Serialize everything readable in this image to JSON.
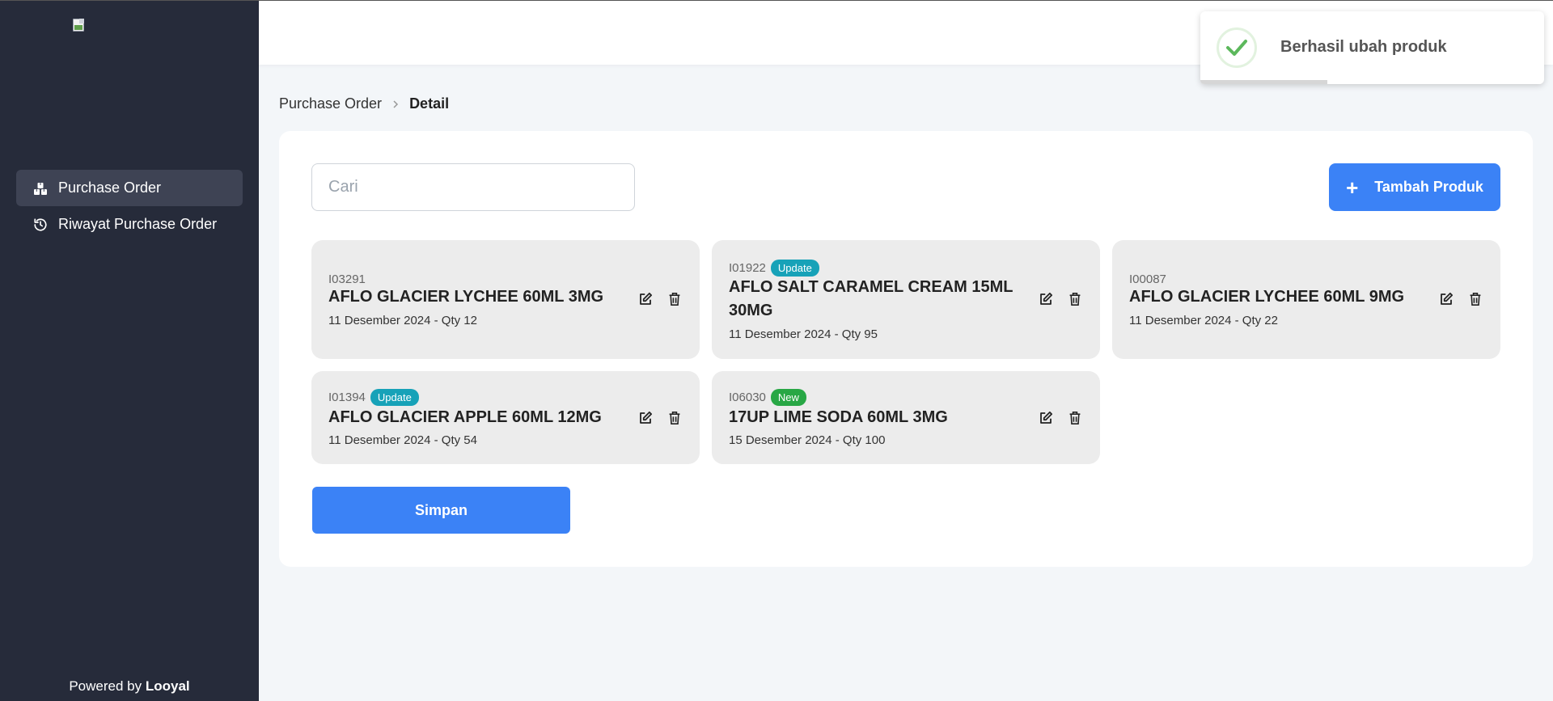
{
  "sidebar": {
    "items": [
      {
        "label": "Purchase Order",
        "icon": "boxes-icon",
        "active": true
      },
      {
        "label": "Riwayat Purchase Order",
        "icon": "history-icon",
        "active": false
      }
    ],
    "powered_prefix": "Powered by",
    "powered_brand": "Looyal"
  },
  "breadcrumb": {
    "parent": "Purchase Order",
    "current": "Detail"
  },
  "search": {
    "placeholder": "Cari",
    "value": ""
  },
  "add_button": {
    "label": "Tambah Produk",
    "icon": "plus-icon"
  },
  "products": [
    {
      "code": "I03291",
      "badge": "",
      "name": "AFLO GLACIER LYCHEE 60ML 3MG",
      "meta": "11 Desember 2024 - Qty 12"
    },
    {
      "code": "I01922",
      "badge": "Update",
      "name": "AFLO SALT CARAMEL CREAM 15ML 30MG",
      "meta": "11 Desember 2024 - Qty 95"
    },
    {
      "code": "I00087",
      "badge": "",
      "name": "AFLO GLACIER LYCHEE 60ML 9MG",
      "meta": "11 Desember 2024 - Qty 22"
    },
    {
      "code": "I01394",
      "badge": "Update",
      "name": "AFLO GLACIER APPLE 60ML 12MG",
      "meta": "11 Desember 2024 - Qty 54"
    },
    {
      "code": "I06030",
      "badge": "New",
      "name": "17UP LIME SODA 60ML 3MG",
      "meta": "15 Desember 2024 - Qty 100"
    }
  ],
  "save_button": {
    "label": "Simpan"
  },
  "toast": {
    "message": "Berhasil ubah produk",
    "icon": "check-circle-icon",
    "progress": 0.37
  },
  "colors": {
    "sidebar_bg": "#262b3a",
    "primary": "#3b82f6",
    "badge_update": "#17a2b8",
    "badge_new": "#28a745",
    "card_bg": "#ececec"
  }
}
